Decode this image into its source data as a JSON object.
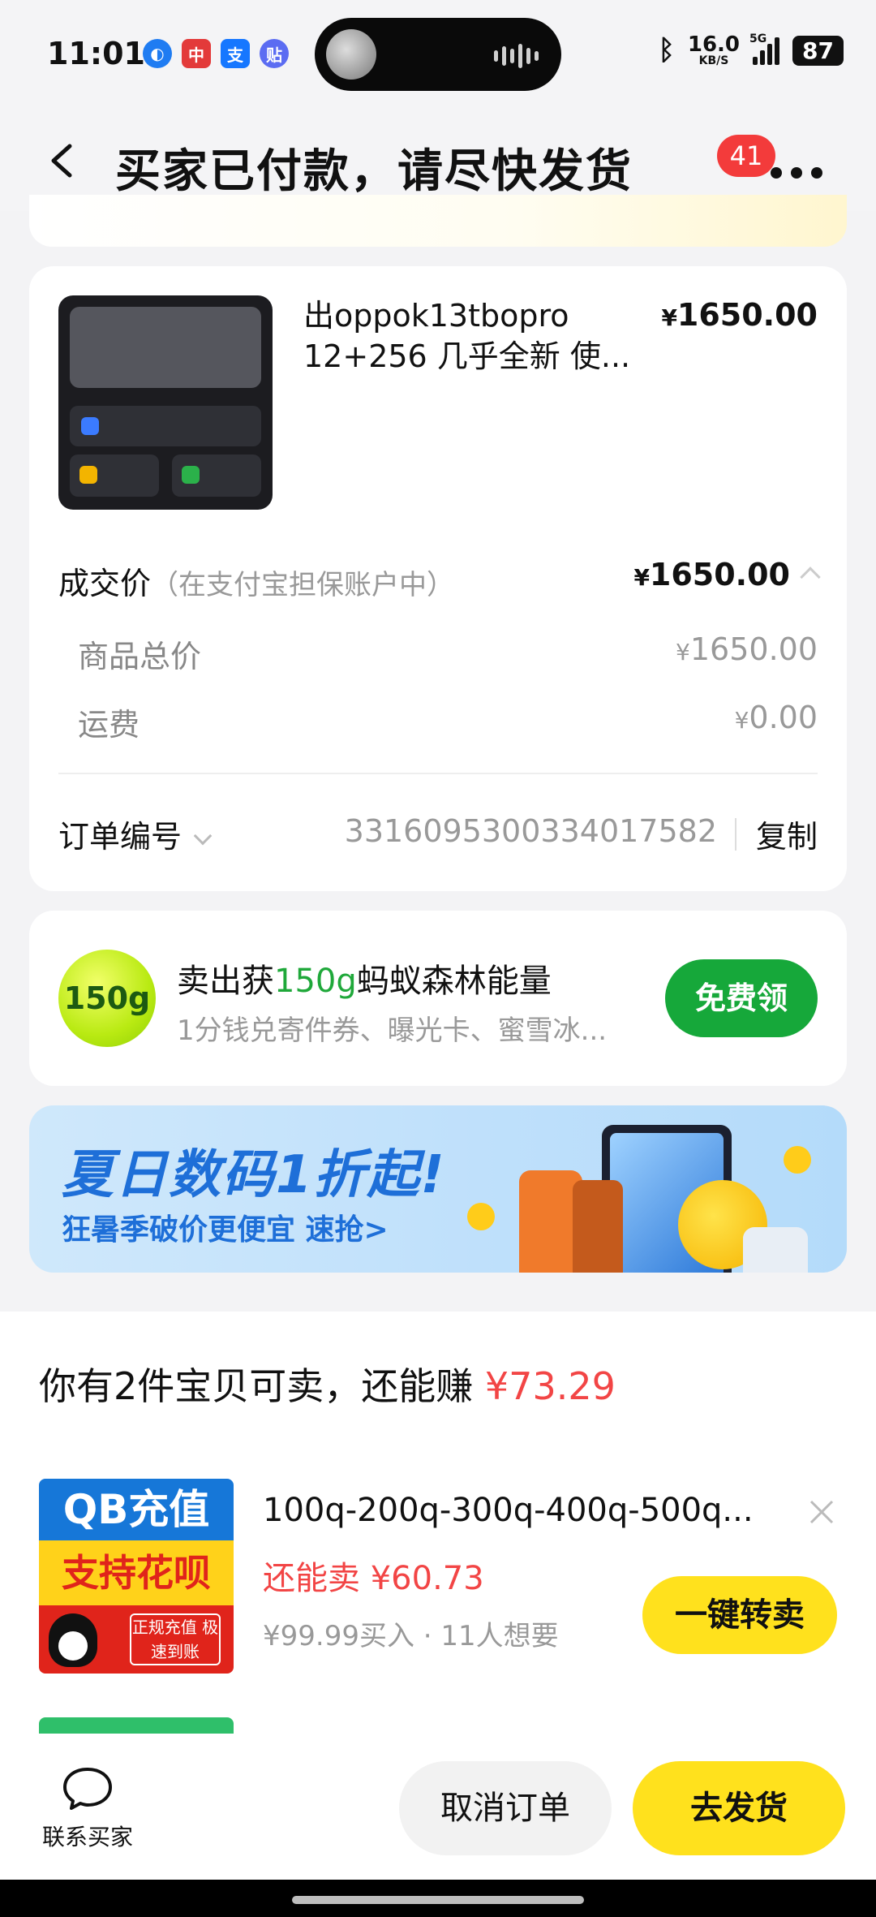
{
  "status_bar": {
    "time": "11:01",
    "apps": [
      {
        "name": "app-icon-blue",
        "glyph": "◐",
        "color": "#1f7cf2"
      },
      {
        "name": "app-icon-red",
        "glyph": "中",
        "color": "#e33a3a"
      },
      {
        "name": "alipay-icon",
        "glyph": "支",
        "color": "#1677ff"
      },
      {
        "name": "tieba-icon",
        "glyph": "贴",
        "color": "#5b6cf2"
      }
    ],
    "net_speed": "16.0",
    "net_unit": "KB/S",
    "network": "5G",
    "battery": "87"
  },
  "header": {
    "title": "买家已付款，请尽快发货",
    "badge_count": "41"
  },
  "order": {
    "product_title": "出oppok13tbopro 12+256 几乎全新 使...",
    "product_price": "1650.00",
    "deal_label": "成交价",
    "deal_note": "（在支付宝担保账户中）",
    "deal_price": "1650.00",
    "subtotal_label": "商品总价",
    "subtotal_value": "1650.00",
    "shipping_label": "运费",
    "shipping_value": "0.00",
    "order_no_label": "订单编号",
    "order_no": "3316095300334017582",
    "copy_label": "复制",
    "currency": "¥"
  },
  "energy": {
    "ball_text": "150g",
    "title_prefix": "卖出获",
    "title_highlight": "150g",
    "title_suffix": "蚂蚁森林能量",
    "subtitle": "1分钱兑寄件券、曝光卡、蜜雪冰...",
    "button": "免费领"
  },
  "banner": {
    "title": "夏日数码1折起!",
    "subtitle": "狂暑季破价更便宜 速抢>"
  },
  "resell": {
    "title_prefix": "你有2件宝贝可卖，还能赚",
    "amount": "¥73.29",
    "item": {
      "image_top": "QB充值",
      "image_mid": "支持花呗",
      "image_tag": "正规充值 极速到账",
      "title": "100q-200q-300q-400q-500q...",
      "sell_label": "还能卖",
      "sell_price": "¥60.73",
      "meta": "¥99.99买入 · 11人想要",
      "button": "一键转卖"
    }
  },
  "actions": {
    "contact": "联系买家",
    "cancel": "取消订单",
    "ship": "去发货"
  }
}
